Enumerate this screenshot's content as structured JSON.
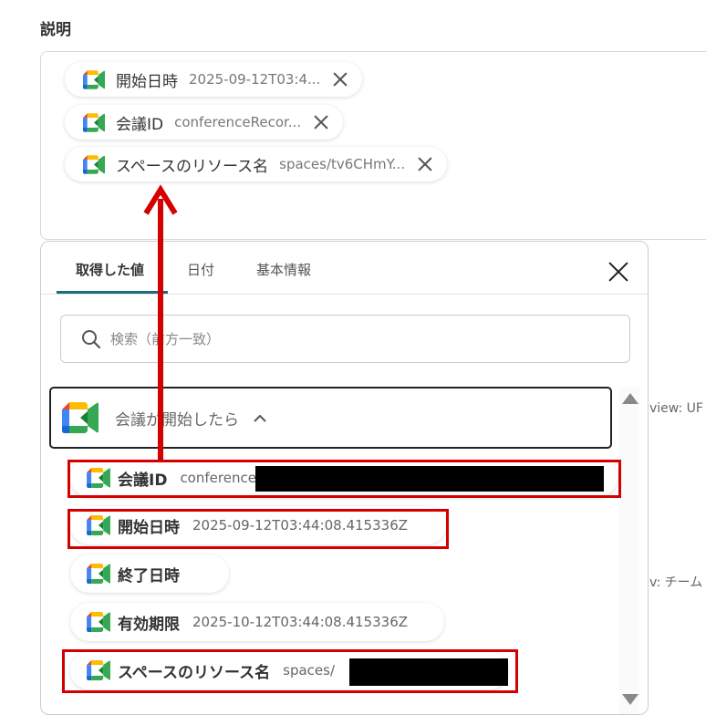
{
  "section_label": "説明",
  "desc_chips": [
    {
      "label": "開始日時",
      "value": "2025-09-12T03:4..."
    },
    {
      "label": "会議ID",
      "value": "conferenceRecor..."
    },
    {
      "label": "スペースのリソース名",
      "value": "spaces/tv6CHmY..."
    }
  ],
  "tabs": [
    {
      "label": "取得した値"
    },
    {
      "label": "日付"
    },
    {
      "label": "基本情報"
    }
  ],
  "search": {
    "placeholder": "検索（前方一致）"
  },
  "group": {
    "label": "会議が開始したら"
  },
  "items": [
    {
      "label": "会議ID",
      "value": "conference"
    },
    {
      "label": "開始日時",
      "value": "2025-09-12T03:44:08.415336Z"
    },
    {
      "label": "終了日時",
      "value": ""
    },
    {
      "label": "有効期限",
      "value": "2025-10-12T03:44:08.415336Z"
    },
    {
      "label": "スペースのリソース名",
      "value": "spaces/"
    }
  ],
  "right_texts": [
    "view: UF",
    "v: チーム"
  ],
  "colors": {
    "annotation_red": "#d40000",
    "tab_accent": "#1e6b7b"
  },
  "icons": {
    "meet": "google-meet-icon",
    "close": "close-icon",
    "search": "search-icon"
  }
}
